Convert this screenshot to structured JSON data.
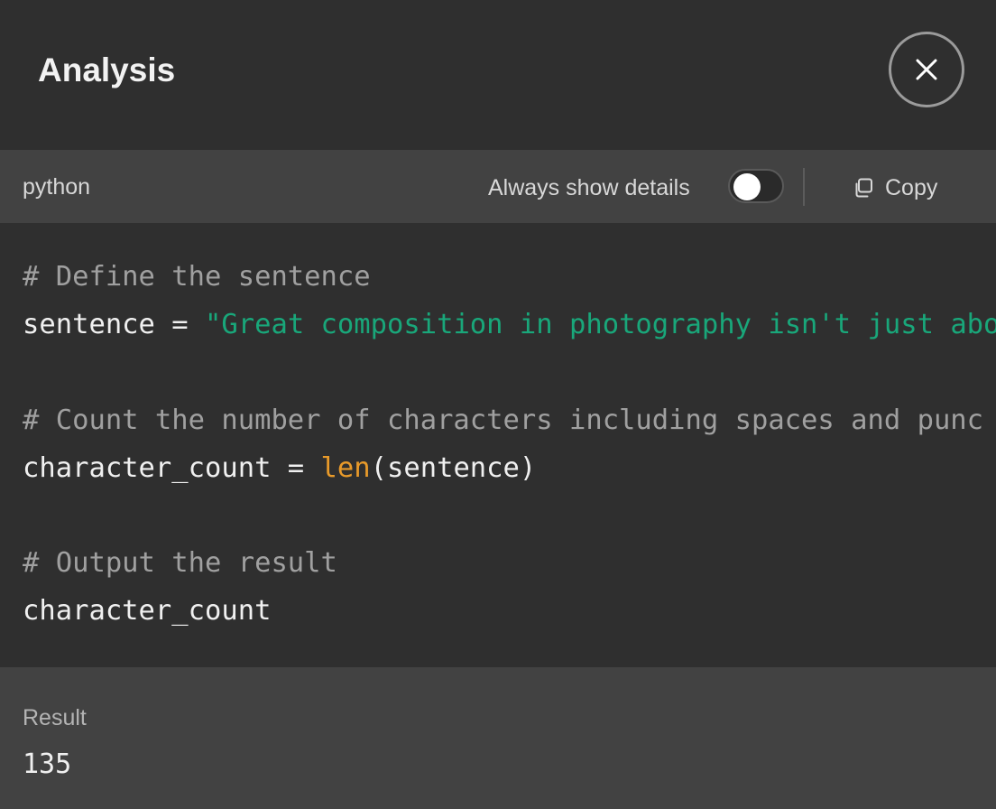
{
  "header": {
    "title": "Analysis",
    "close_icon": "close-icon"
  },
  "toolbar": {
    "language": "python",
    "details_label": "Always show details",
    "details_toggle_on": false,
    "copy_label": "Copy",
    "copy_icon": "copy-icon"
  },
  "code": {
    "lines": [
      [
        {
          "t": "comment",
          "v": "# Define the sentence"
        }
      ],
      [
        {
          "t": "plain",
          "v": "sentence = "
        },
        {
          "t": "string",
          "v": "\"Great composition in photography isn't just abo"
        }
      ],
      [],
      [
        {
          "t": "comment",
          "v": "# Count the number of characters including spaces and punc"
        }
      ],
      [
        {
          "t": "plain",
          "v": "character_count = "
        },
        {
          "t": "builtin",
          "v": "len"
        },
        {
          "t": "plain",
          "v": "(sentence)"
        }
      ],
      [],
      [
        {
          "t": "comment",
          "v": "# Output the result"
        }
      ],
      [
        {
          "t": "plain",
          "v": "character_count"
        }
      ]
    ]
  },
  "result": {
    "label": "Result",
    "value": "135"
  },
  "colors": {
    "background": "#2f2f2f",
    "panel": "#424242",
    "comment": "#a0a0a0",
    "string": "#19a77a",
    "builtin": "#e89a2a"
  }
}
